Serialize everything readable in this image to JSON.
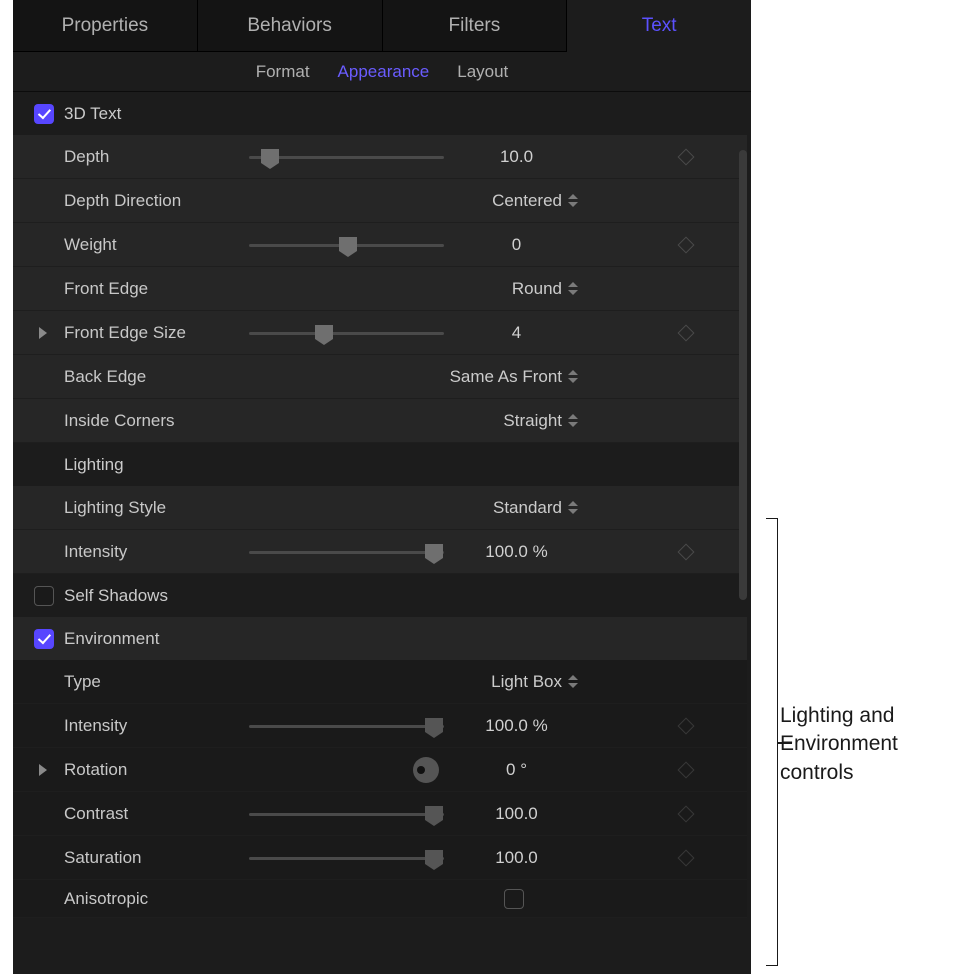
{
  "mainTabs": [
    "Properties",
    "Behaviors",
    "Filters",
    "Text"
  ],
  "subTabs": [
    "Format",
    "Appearance",
    "Layout"
  ],
  "sectionThreeD": {
    "title": "3D Text",
    "rows": {
      "depth": {
        "label": "Depth",
        "value": "10.0",
        "sliderPct": 6
      },
      "depthDirection": {
        "label": "Depth Direction",
        "value": "Centered"
      },
      "weight": {
        "label": "Weight",
        "value": "0",
        "sliderPct": 48
      },
      "frontEdge": {
        "label": "Front Edge",
        "value": "Round"
      },
      "frontEdgeSize": {
        "label": "Front Edge Size",
        "value": "4",
        "sliderPct": 38
      },
      "backEdge": {
        "label": "Back Edge",
        "value": "Same As Front"
      },
      "insideCorners": {
        "label": "Inside Corners",
        "value": "Straight"
      }
    }
  },
  "sectionLighting": {
    "title": "Lighting",
    "rows": {
      "lightingStyle": {
        "label": "Lighting Style",
        "value": "Standard"
      },
      "intensity": {
        "label": "Intensity",
        "value": "100.0",
        "unit": "%",
        "sliderPct": 92
      }
    }
  },
  "selfShadows": {
    "label": "Self Shadows",
    "checked": false
  },
  "environment": {
    "label": "Environment",
    "checked": true,
    "rows": {
      "type": {
        "label": "Type",
        "value": "Light Box"
      },
      "intensity": {
        "label": "Intensity",
        "value": "100.0",
        "unit": "%",
        "sliderPct": 92
      },
      "rotation": {
        "label": "Rotation",
        "value": "0",
        "unit": "°"
      },
      "contrast": {
        "label": "Contrast",
        "value": "100.0",
        "sliderPct": 92
      },
      "saturation": {
        "label": "Saturation",
        "value": "100.0",
        "sliderPct": 92
      },
      "anisotropic": {
        "label": "Anisotropic"
      }
    }
  },
  "annotation": "Lighting and Environment controls"
}
